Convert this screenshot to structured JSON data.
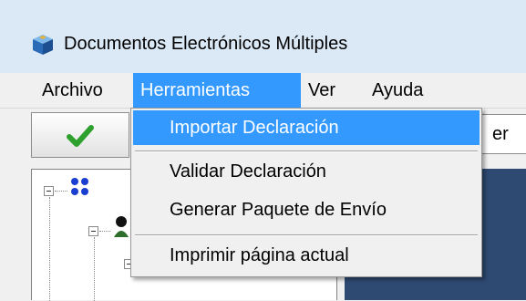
{
  "window": {
    "title": "Documentos Electrónicos Múltiples",
    "icon": "blue-cube-icon"
  },
  "menubar": {
    "items": [
      {
        "label": "Archivo",
        "active": false
      },
      {
        "label": "Herramientas",
        "active": true
      },
      {
        "label": "Ver",
        "active": false
      },
      {
        "label": "Ayuda",
        "active": false
      }
    ]
  },
  "dropdown": {
    "items": [
      {
        "label": "Importar Declaración",
        "highlighted": true
      },
      {
        "label": "Validar Declaración",
        "highlighted": false
      },
      {
        "label": "Generar Paquete de Envío",
        "highlighted": false
      },
      {
        "label": "Imprimir página actual",
        "highlighted": false
      }
    ]
  },
  "toolbar": {
    "confirm_icon": "green-checkmark-icon",
    "combo_text": "er"
  },
  "tree": {
    "root_icon": "blue-dots-icon",
    "child_icon": "person-icon"
  },
  "colors": {
    "highlight": "#3399ff",
    "titlebar": "#dbe8f6",
    "right_panel": "#2e4a72",
    "check_green": "#2ea02e"
  }
}
